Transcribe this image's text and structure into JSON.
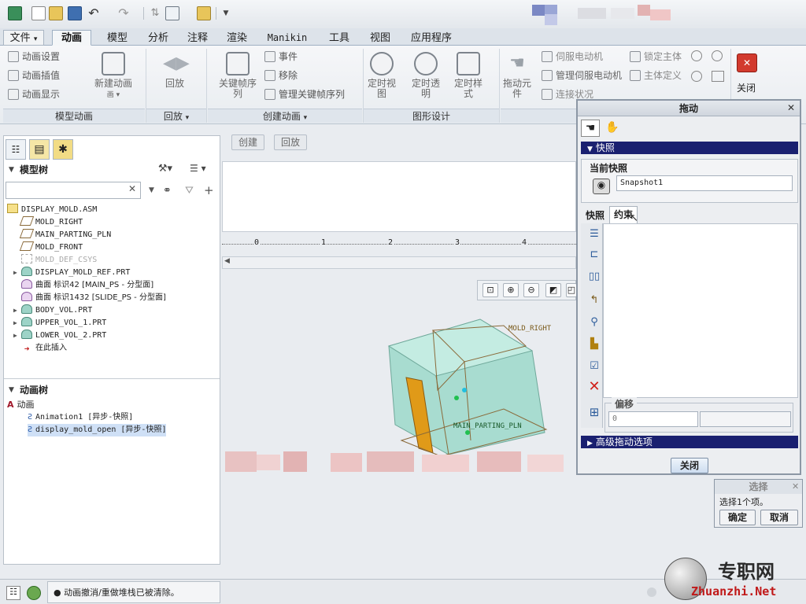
{
  "quick_access": {
    "icons": [
      "app-icon",
      "new-icon",
      "open-icon",
      "save-icon",
      "undo-icon",
      "redo-icon",
      "regen-icon",
      "window-icon",
      "folder-icon",
      "customize-icon"
    ]
  },
  "tabs": [
    {
      "label": "文件",
      "caret": "▾"
    },
    {
      "label": "动画"
    },
    {
      "label": "模型"
    },
    {
      "label": "分析"
    },
    {
      "label": "注释"
    },
    {
      "label": "渲染"
    },
    {
      "label": "Manikin"
    },
    {
      "label": "工具"
    },
    {
      "label": "视图"
    },
    {
      "label": "应用程序"
    }
  ],
  "ribbon": {
    "anim_settings": "动画设置",
    "anim_interp": "动画插值",
    "anim_display": "动画显示",
    "new_anim": "新建动画",
    "playback_big": "回放",
    "keyframe_seq": "关键帧序列",
    "event": "事件",
    "move": "移除",
    "manage_kfs": "管理关键帧序列",
    "timed_view": "定时视图",
    "timed_transp": "定时透明",
    "timed_style": "定时样式",
    "drag_component": "拖动元件",
    "servo_motor": "伺服电动机",
    "manage_servo": "管理伺服电动机",
    "connect_status": "连接状况",
    "lock_body": "锁定主体",
    "body_def": "主体定义",
    "close": "关闭",
    "groups": {
      "model_anim": "模型动画",
      "playback": "回放",
      "create_anim": "创建动画",
      "graphic_design": "图形设计"
    }
  },
  "center_buttons": {
    "create": "创建",
    "playback": "回放"
  },
  "ruler": {
    "ticks": [
      "0",
      "1",
      "2",
      "3",
      "4"
    ]
  },
  "model_tree": {
    "title": "模型树",
    "search_placeholder": "",
    "items": [
      {
        "text": "DISPLAY_MOLD.ASM",
        "level": 0,
        "expand": "",
        "dim": false,
        "icon": "assembly"
      },
      {
        "text": "MOLD_RIGHT",
        "level": 1,
        "expand": "",
        "dim": false,
        "icon": "plane"
      },
      {
        "text": "MAIN_PARTING_PLN",
        "level": 1,
        "expand": "",
        "dim": false,
        "icon": "plane"
      },
      {
        "text": "MOLD_FRONT",
        "level": 1,
        "expand": "",
        "dim": false,
        "icon": "plane"
      },
      {
        "text": "MOLD_DEF_CSYS",
        "level": 1,
        "expand": "",
        "dim": true,
        "icon": "csys"
      },
      {
        "text": "DISPLAY_MOLD_REF.PRT",
        "level": 1,
        "expand": "▶",
        "dim": false,
        "icon": "part"
      },
      {
        "text": "曲面 标识42 [MAIN_PS - 分型面]",
        "level": 1,
        "expand": "",
        "dim": false,
        "icon": "surface"
      },
      {
        "text": "曲面 标识1432 [SLIDE_PS - 分型面]",
        "level": 1,
        "expand": "",
        "dim": false,
        "icon": "surface"
      },
      {
        "text": "BODY_VOL.PRT",
        "level": 1,
        "expand": "▶",
        "dim": false,
        "icon": "part"
      },
      {
        "text": "UPPER_VOL_1.PRT",
        "level": 1,
        "expand": "▶",
        "dim": false,
        "icon": "part"
      },
      {
        "text": "LOWER_VOL_2.PRT",
        "level": 1,
        "expand": "▶",
        "dim": false,
        "icon": "part"
      },
      {
        "text": "在此插入",
        "level": 1,
        "expand": "",
        "dim": false,
        "icon": "insert"
      }
    ]
  },
  "anim_tree": {
    "title": "动画树",
    "root": "动画",
    "items": [
      "Animation1 [异步-快照]",
      "display_mold_open [异步-快照]"
    ]
  },
  "viewport": {
    "label_right": "MOLD_RIGHT",
    "label_parting": "MAIN_PARTING_PLN",
    "box_color": "#a8dcd0",
    "line_color": "#8a6a3a",
    "accent_color": "#e09a18"
  },
  "drag_dialog": {
    "title": "拖动",
    "snapshot_section": "快照",
    "current_snapshot": "当前快照",
    "snapshot_value": "Snapshot1",
    "tab_snapshot": "快照",
    "tab_constraint": "约束",
    "offset_label": "偏移",
    "offset_value": "0",
    "advanced": "高级拖动选项",
    "close": "关闭"
  },
  "select_dialog": {
    "title": "选择",
    "message": "选择1个项。",
    "ok": "确定",
    "cancel": "取消"
  },
  "status": {
    "message": "● 动画撤消/重做堆栈已被清除。"
  },
  "watermark": {
    "name": "专职网",
    "url": "Zhuanzhi.Net"
  }
}
